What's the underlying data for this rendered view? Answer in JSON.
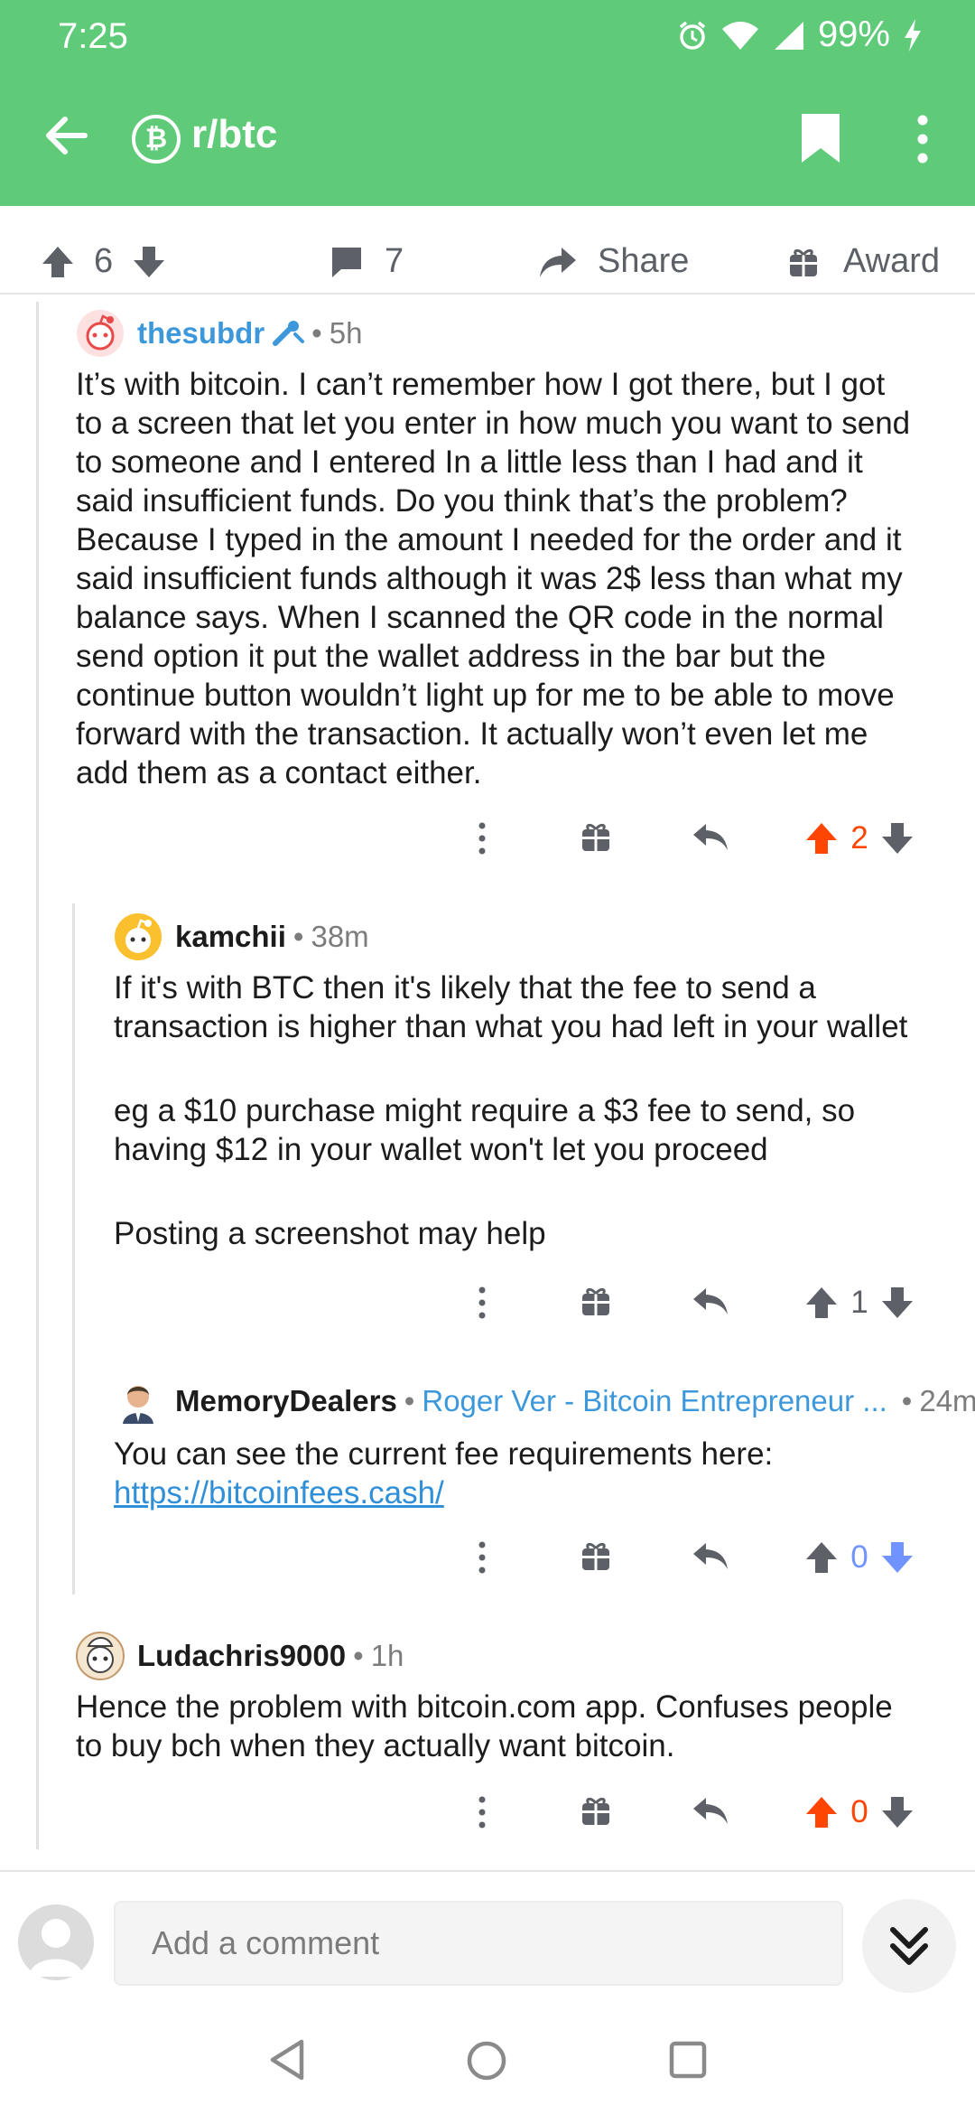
{
  "status_bar": {
    "time": "7:25",
    "battery": "99%"
  },
  "app_bar": {
    "subreddit": "r/btc",
    "sub_icon_glyph": "₿"
  },
  "post_actions": {
    "score": "6",
    "comments": "7",
    "share": "Share",
    "award": "Award"
  },
  "comments": [
    {
      "author": "thesubdr",
      "time": "5h",
      "body": [
        "It’s with bitcoin. I can’t remember how I got there, but I got",
        "to a screen that let you enter in how much you want to send",
        "to someone and I entered In a little less than I had and it",
        "said insufficient funds. Do you think that’s the problem?",
        "Because I typed in the amount I needed for the order and it",
        "said insufficient funds although it was 2$ less than what my",
        "balance says. When I scanned the QR code in the normal",
        "send option it put the wallet address in the bar but the",
        "continue button wouldn’t light up for me to be able to move",
        "forward with the transaction. It actually won’t even let me",
        "add them as a contact either."
      ],
      "score": "2",
      "vote_state": "up"
    },
    {
      "author": "kamchii",
      "time": "38m",
      "body": [
        "If it's with BTC then it's likely that the fee to send a",
        "transaction is higher than what you had left in your wallet",
        "",
        "eg a $10 purchase might require a $3 fee to send, so",
        "having $12 in your wallet won't let you proceed",
        "",
        "Posting a screenshot may help"
      ],
      "score": "1",
      "vote_state": "none"
    },
    {
      "author": "MemoryDealers",
      "flair": "Roger Ver - Bitcoin Entrepreneur ...",
      "time": "24m",
      "body_text": "You can see the current fee requirements here:",
      "link": "https://bitcoinfees.cash/",
      "score": "0",
      "vote_state": "down"
    },
    {
      "author": "Ludachris9000",
      "time": "1h",
      "body": [
        "Hence the problem with bitcoin.com app. Confuses people",
        "to buy bch when they actually want bitcoin."
      ],
      "score": "0",
      "vote_state": "up"
    }
  ],
  "composer": {
    "placeholder": "Add a comment"
  },
  "colors": {
    "header": "#5fcb78",
    "upvote": "#ff4500",
    "downvote": "#7193ff",
    "link": "#2f8fd8"
  },
  "icons": [
    "arrow-back-icon",
    "bitcoin-icon",
    "bookmark-icon",
    "more-vert-icon",
    "upvote-icon",
    "downvote-icon",
    "comment-icon",
    "share-icon",
    "gift-icon",
    "reply-icon",
    "collapse-icon",
    "nav-back-icon",
    "nav-home-icon",
    "nav-recents-icon"
  ]
}
